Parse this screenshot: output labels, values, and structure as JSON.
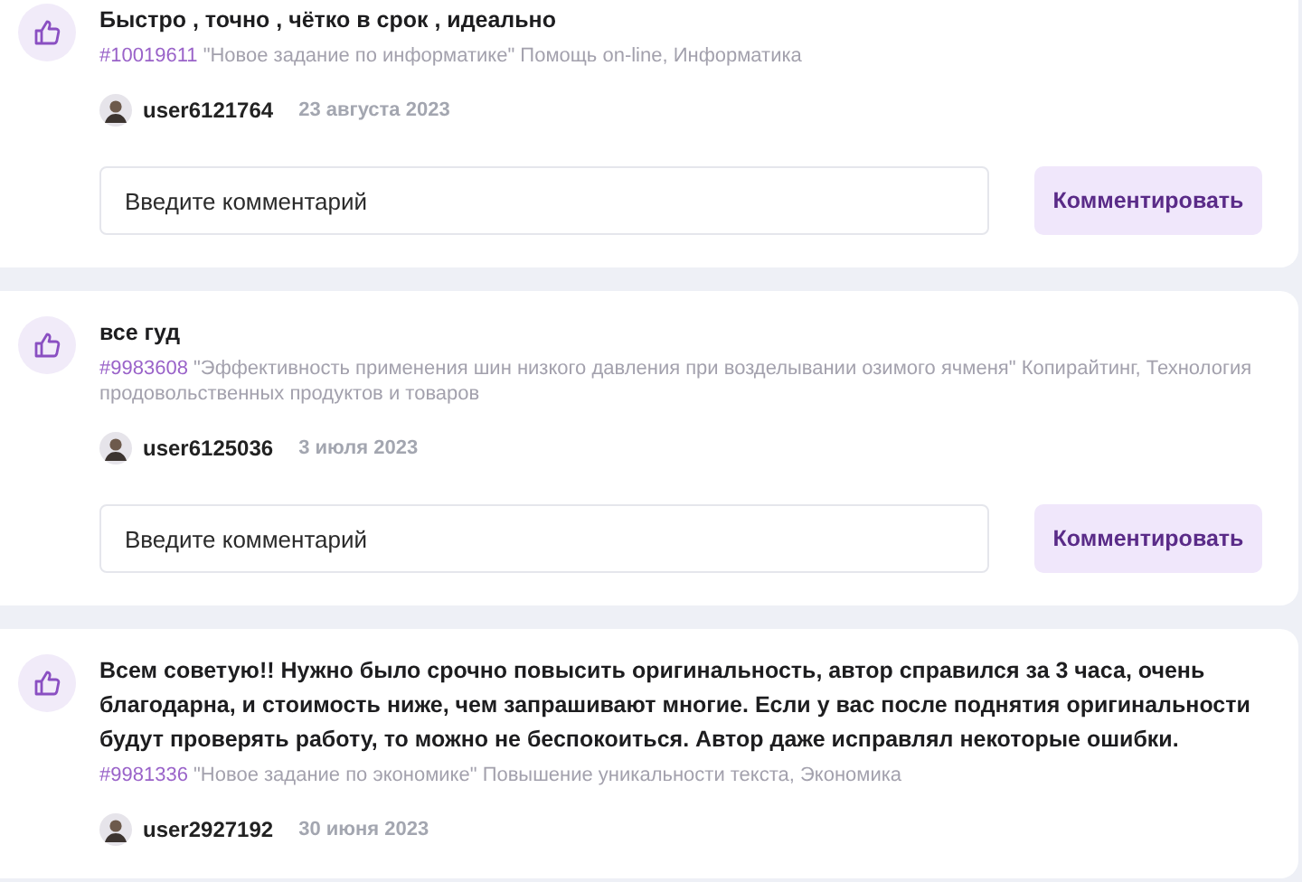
{
  "reviews": [
    {
      "text": "Быстро , точно , чётко в срок , идеально",
      "order_number": "#10019611",
      "order_title": "\"Новое задание по информатике\"",
      "categories": "Помощь on-line, Информатика",
      "user": "user6121764",
      "date": "23 августа 2023",
      "comment_placeholder": "Введите комментарий",
      "button": "Комментировать"
    },
    {
      "text": "все гуд",
      "order_number": "#9983608",
      "order_title": "\"Эффективность применения шин низкого давления при возделывании озимого ячменя\"",
      "categories": "Копирайтинг, Технология продовольственных продуктов и товаров",
      "user": "user6125036",
      "date": "3 июля 2023",
      "comment_placeholder": "Введите комментарий",
      "button": "Комментировать"
    },
    {
      "text": "Всем советую!! Нужно было срочно повысить оригинальность, автор справился за 3 часа, очень благодарна, и стоимость ниже, чем запрашивают многие. Если у вас после поднятия оригинальности будут проверять работу, то можно не беспокоиться. Автор даже исправлял некоторые ошибки.",
      "order_number": "#9981336",
      "order_title": "\"Новое задание по экономике\"",
      "categories": "Повышение уникальности текста, Экономика",
      "user": "user2927192",
      "date": "30 июня 2023"
    }
  ]
}
